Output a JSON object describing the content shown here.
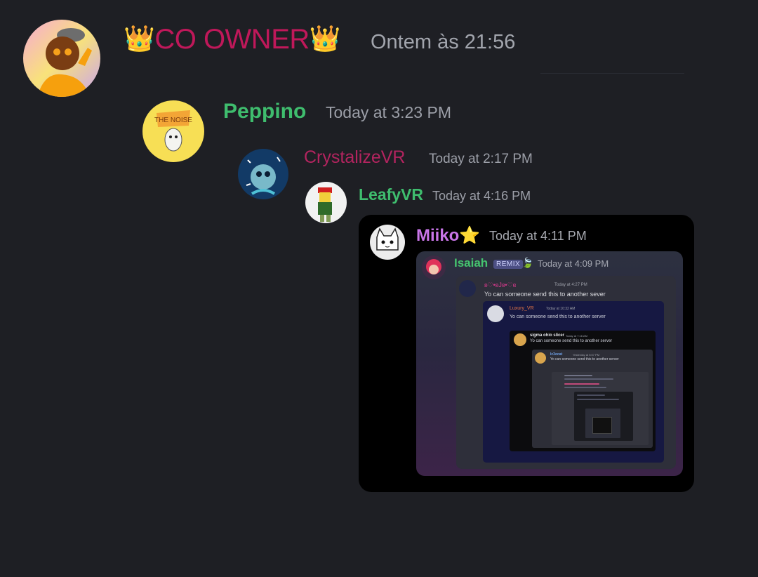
{
  "messages": {
    "co_owner": {
      "crown_left": "👑",
      "username": "CO OWNER",
      "crown_right": "👑",
      "timestamp": "Ontem às 21:56"
    },
    "peppino": {
      "username": "Peppino",
      "timestamp": "Today at 3:23 PM",
      "avatar_text": "THE NOISE"
    },
    "crystalize": {
      "username": "CrystalizeVR",
      "timestamp": "Today at 2:17 PM"
    },
    "leafy": {
      "username": "LeafyVR",
      "timestamp": "Today at 4:16 PM"
    }
  },
  "card": {
    "username": "Miiko",
    "star": "⭐",
    "timestamp": "Today at 4:11 PM",
    "quote1": {
      "username": "Isaiah",
      "badge": "REMIX",
      "leaf": "🍃",
      "timestamp": "Today at 4:09 PM"
    },
    "quote2": {
      "username": "ʚ♡•ʚJɞ•♡ɞ",
      "timestamp": "Today at 4:27 PM",
      "message": "Yo can someone send this to another sever"
    },
    "quote3": {
      "username": "Luxury_VR",
      "timestamp": "Today at 10:32 AM",
      "message": "Yo can someone send this to another server"
    },
    "quote4": {
      "username": "sigma ohio slicer",
      "timestamp": "Today at 7:16 AM",
      "message": "Yo can someone send this to another server"
    },
    "quote5": {
      "username": "Ic3ocat",
      "timestamp": "Yesterday at 5:07 PM",
      "message": "Yo can someone send this to another server"
    }
  },
  "colors": {
    "background": "#1e1f24",
    "co_owner_name": "#c0185a",
    "green_name": "#3fbd6e",
    "crystalize_name": "#b3245f",
    "miiko_name": "#c976e8",
    "timestamp": "#9c9fa8"
  }
}
